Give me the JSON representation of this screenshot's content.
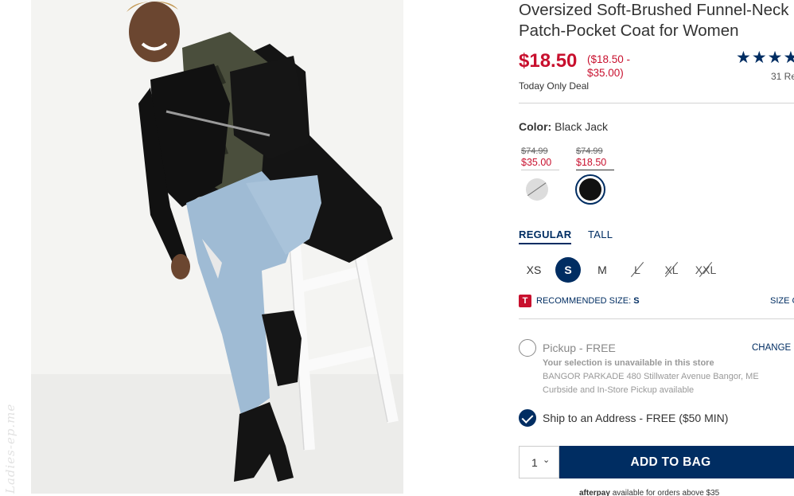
{
  "watermark": "Ladies-ep.me",
  "product": {
    "title_line1": "Oversized Soft-Brushed Funnel-Neck",
    "title_line2": "Patch-Pocket Coat for Women",
    "price": "$18.50",
    "price_range": "($18.50 - $35.00)",
    "deal": "Today Only Deal",
    "stars": "★★★★",
    "reviews": "31 Re"
  },
  "color": {
    "label": "Color:",
    "value": "Black Jack",
    "swatches": [
      {
        "old_price": "$74.99",
        "new_price": "$35.00",
        "color": "#dcdcdc",
        "available": false
      },
      {
        "old_price": "$74.99",
        "new_price": "$18.50",
        "color": "#111111",
        "available": true,
        "selected": true
      }
    ]
  },
  "fit_tabs": [
    {
      "label": "REGULAR",
      "active": true
    },
    {
      "label": "TALL",
      "active": false
    }
  ],
  "sizes": [
    {
      "label": "XS",
      "state": "available"
    },
    {
      "label": "S",
      "state": "selected"
    },
    {
      "label": "M",
      "state": "available"
    },
    {
      "label": "L",
      "state": "unavailable"
    },
    {
      "label": "XL",
      "state": "unavailable"
    },
    {
      "label": "XXL",
      "state": "unavailable"
    }
  ],
  "recommend": {
    "badge": "T",
    "label": "RECOMMENDED SIZE:",
    "size": "S",
    "size_chart": "SIZE C"
  },
  "fulfillment": {
    "pickup_label": "Pickup - FREE",
    "change_store": "CHANGE S",
    "unavailable_msg": "Your selection is unavailable in this store",
    "store_address": "BANGOR PARKADE 480 Stillwater Avenue  Bangor, ME",
    "curbside": "Curbside and In-Store Pickup available",
    "ship_label": "Ship to an Address - FREE ($50 MIN)"
  },
  "cart": {
    "qty": "1",
    "add_label": "ADD TO BAG"
  },
  "afterpay": {
    "brand": "afterpay",
    "text": "available for orders above $35"
  },
  "colors": {
    "brand_navy": "#002d62",
    "sale_red": "#c8102e"
  }
}
